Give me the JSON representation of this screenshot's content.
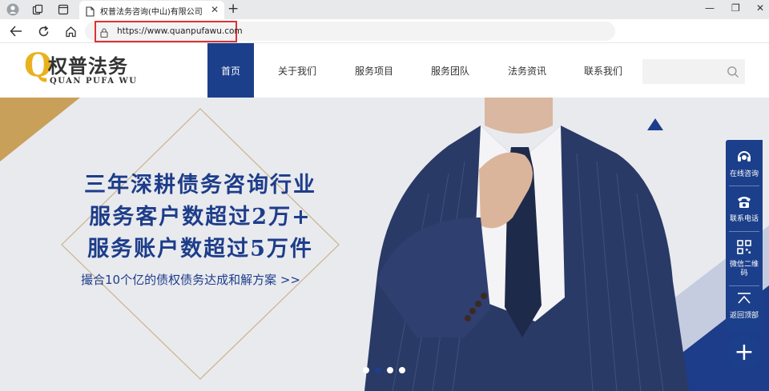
{
  "browser": {
    "tab_title": "权普法务咨询(中山)有限公司",
    "url": "https://www.quanpufawu.com",
    "new_tab": "+",
    "close_tab": "✕"
  },
  "site": {
    "logo": {
      "letter": "Q",
      "name": "权普法务",
      "english": "QUAN PUFA WU"
    },
    "nav": [
      "首页",
      "关于我们",
      "服务项目",
      "服务团队",
      "法务资讯",
      "联系我们"
    ],
    "search_placeholder": ""
  },
  "banner": {
    "headline_lines": [
      "三年深耕债务咨询行业",
      "服务客户数超过2万+",
      "服务账户数超过5万件"
    ],
    "sub_link": "撮合10个亿的债权债务达成和解方案 >>",
    "slides": 4,
    "active_slide": 2
  },
  "float_bar": {
    "items": [
      "在线咨询",
      "联系电话",
      "微信二维码",
      "返回顶部"
    ],
    "plus": "+"
  },
  "colors": {
    "brand_blue": "#1b3f8b",
    "logo_gold": "#e9b21d",
    "banner_bg": "#e9eaee"
  }
}
